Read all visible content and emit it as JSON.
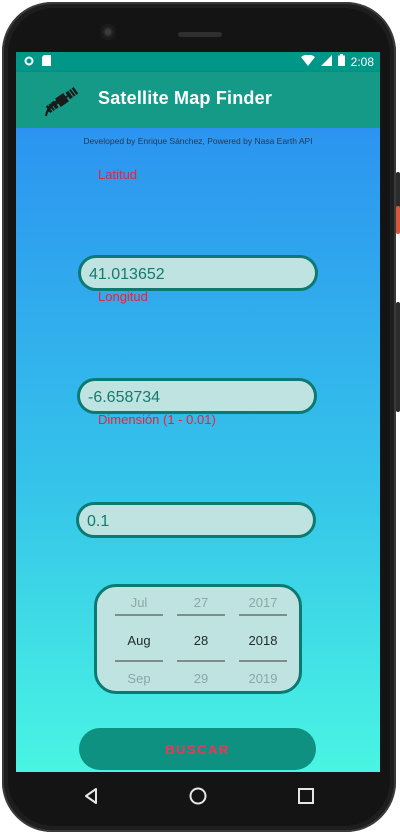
{
  "status_bar": {
    "time": "2:08",
    "icons": [
      "circle-icon",
      "sd-card-icon",
      "wifi-icon",
      "signal-icon",
      "battery-icon"
    ]
  },
  "app_bar": {
    "title": "Satellite Map Finder",
    "icon": "satellite-icon"
  },
  "credit": "Developed by Enrique Sánchez, Powered by Nasa Earth API",
  "fields": {
    "latitude": {
      "label": "Latitud",
      "value": "41.013652"
    },
    "longitude": {
      "label": "Longitud",
      "value": "-6.658734"
    },
    "dimension": {
      "label": "Dimensión (1 - 0.01)",
      "value": "0.1"
    }
  },
  "date_picker": {
    "month": {
      "prev": "Jul",
      "selected": "Aug",
      "next": "Sep"
    },
    "day": {
      "prev": "27",
      "selected": "28",
      "next": "29"
    },
    "year": {
      "prev": "2017",
      "selected": "2018",
      "next": "2019"
    }
  },
  "search_button": {
    "label": "BUSCAR"
  },
  "nav_bar": {
    "icons": [
      "back-icon",
      "home-icon",
      "recents-icon"
    ]
  },
  "colors": {
    "status_bar": "#009688",
    "app_bar": "#159a88",
    "label_red": "#e8233a",
    "field_border": "#0c7a73",
    "field_fill": "#bfe3e0",
    "button_fill": "#0f9181",
    "button_text": "#ff2b5a"
  }
}
